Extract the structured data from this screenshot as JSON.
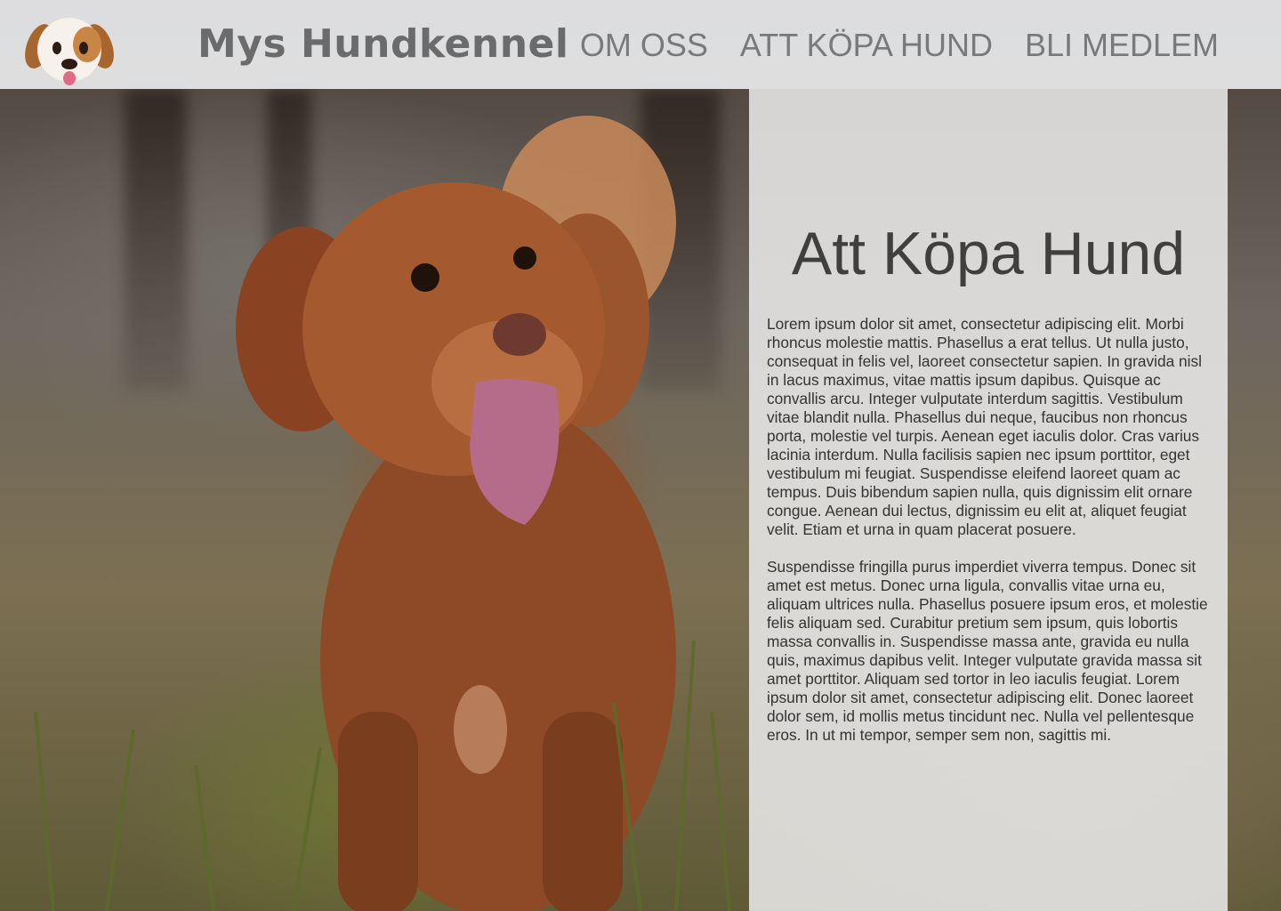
{
  "header": {
    "logo_icon": "dog-face-icon",
    "site_title": "Mys Hundkennel",
    "nav": [
      {
        "label": "OM OSS"
      },
      {
        "label": "ATT KÖPA HUND"
      },
      {
        "label": "BLI MEDLEM"
      }
    ]
  },
  "hero": {
    "image": "brown-dog-in-meadow-photo"
  },
  "main": {
    "title": "Att Köpa Hund",
    "paragraphs": [
      "Lorem ipsum dolor sit amet, consectetur adipiscing elit. Morbi rhoncus molestie mattis. Phasellus a erat tellus. Ut nulla justo, consequat in felis vel, laoreet consectetur sapien. In gravida nisl in lacus maximus, vitae mattis ipsum dapibus. Quisque ac convallis arcu. Integer vulputate interdum sagittis. Vestibulum vitae blandit nulla. Phasellus dui neque, faucibus non rhoncus porta, molestie vel turpis. Aenean eget iaculis dolor. Cras varius lacinia interdum. Nulla facilisis sapien nec ipsum porttitor, eget vestibulum mi feugiat. Suspendisse eleifend laoreet quam ac tempus. Duis bibendum sapien nulla, quis dignissim elit ornare congue. Aenean dui lectus, dignissim eu elit at, aliquet feugiat velit. Etiam et urna in quam placerat posuere.",
      "Suspendisse fringilla purus imperdiet viverra tempus. Donec sit amet est metus. Donec urna ligula, convallis vitae urna eu, aliquam ultrices nulla. Phasellus posuere ipsum eros, et molestie felis aliquam sed. Curabitur pretium sem ipsum, quis lobortis massa convallis in. Suspendisse massa ante, gravida eu nulla quis, maximus dapibus velit. Integer vulputate gravida massa sit amet porttitor. Aliquam sed tortor in leo iaculis feugiat. Lorem ipsum dolor sit amet, consectetur adipiscing elit. Donec laoreet dolor sem, id mollis metus tincidunt nec. Nulla vel pellentesque eros. In ut mi tempor, semper sem non, sagittis mi."
    ]
  },
  "colors": {
    "header_bg": "#e8eaec",
    "title_text": "#6b6b6b",
    "nav_text": "#7a7a7a",
    "panel_bg": "#e8e8e8",
    "body_text": "#333333"
  }
}
